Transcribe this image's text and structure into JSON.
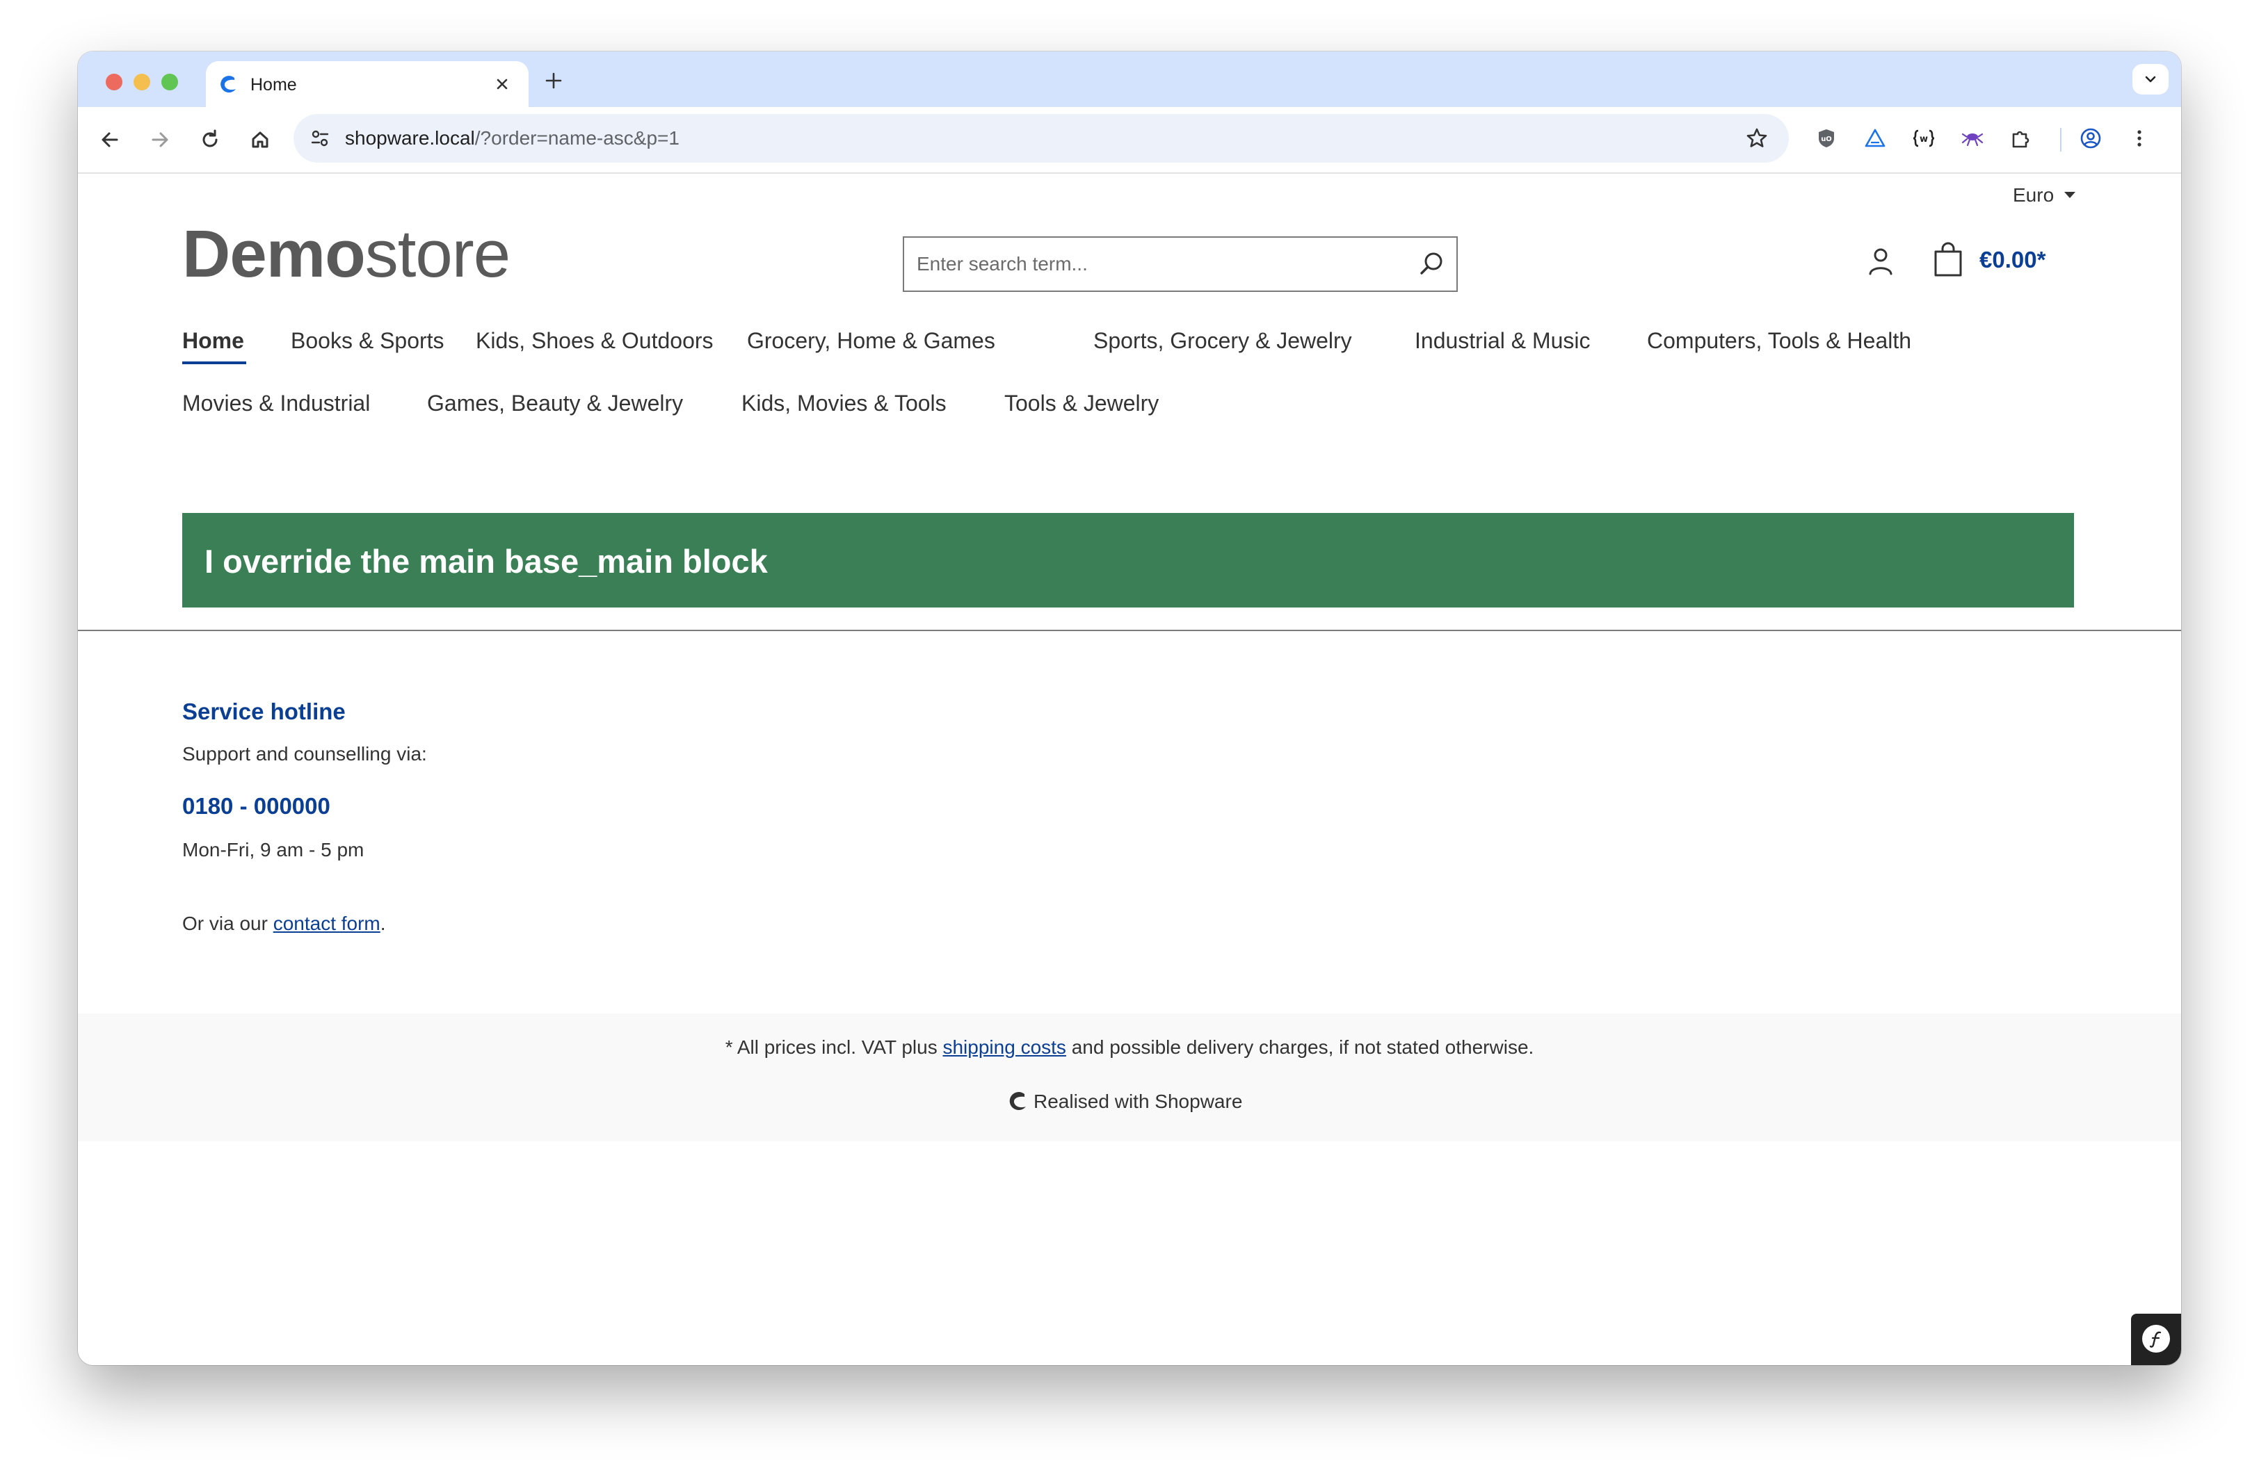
{
  "browser": {
    "tab_title": "Home",
    "url_host": "shopware.local",
    "url_path": "/?order=name-asc&p=1"
  },
  "header": {
    "currency": "Euro",
    "logo_bold": "Demo",
    "logo_light": "store",
    "search_placeholder": "Enter search term...",
    "cart_total": "€0.00*"
  },
  "nav": {
    "items": [
      "Home",
      "Books & Sports",
      "Kids, Shoes & Outdoors",
      "Grocery, Home & Games",
      "Sports, Grocery & Jewelry",
      "Industrial & Music",
      "Computers, Tools & Health",
      "Movies & Industrial",
      "Games, Beauty & Jewelry",
      "Kids, Movies & Tools",
      "Tools & Jewelry"
    ],
    "active": "Home"
  },
  "banner": {
    "text": "I override the main base_main block",
    "color": "#3a7f55"
  },
  "service": {
    "title": "Service hotline",
    "subtitle": "Support and counselling via:",
    "phone": "0180 - 000000",
    "hours": "Mon-Fri, 9 am - 5 pm",
    "contact_prefix": "Or via our ",
    "contact_link": "contact form",
    "contact_suffix": "."
  },
  "footer": {
    "vat_prefix": "* All prices incl. VAT plus ",
    "vat_link": "shipping costs",
    "vat_suffix": " and possible delivery charges, if not stated otherwise.",
    "realised": "Realised with Shopware"
  },
  "colors": {
    "accent": "#0b3f94",
    "tabstrip": "#d3e3fd",
    "footer_bg": "#f9f9f9"
  }
}
